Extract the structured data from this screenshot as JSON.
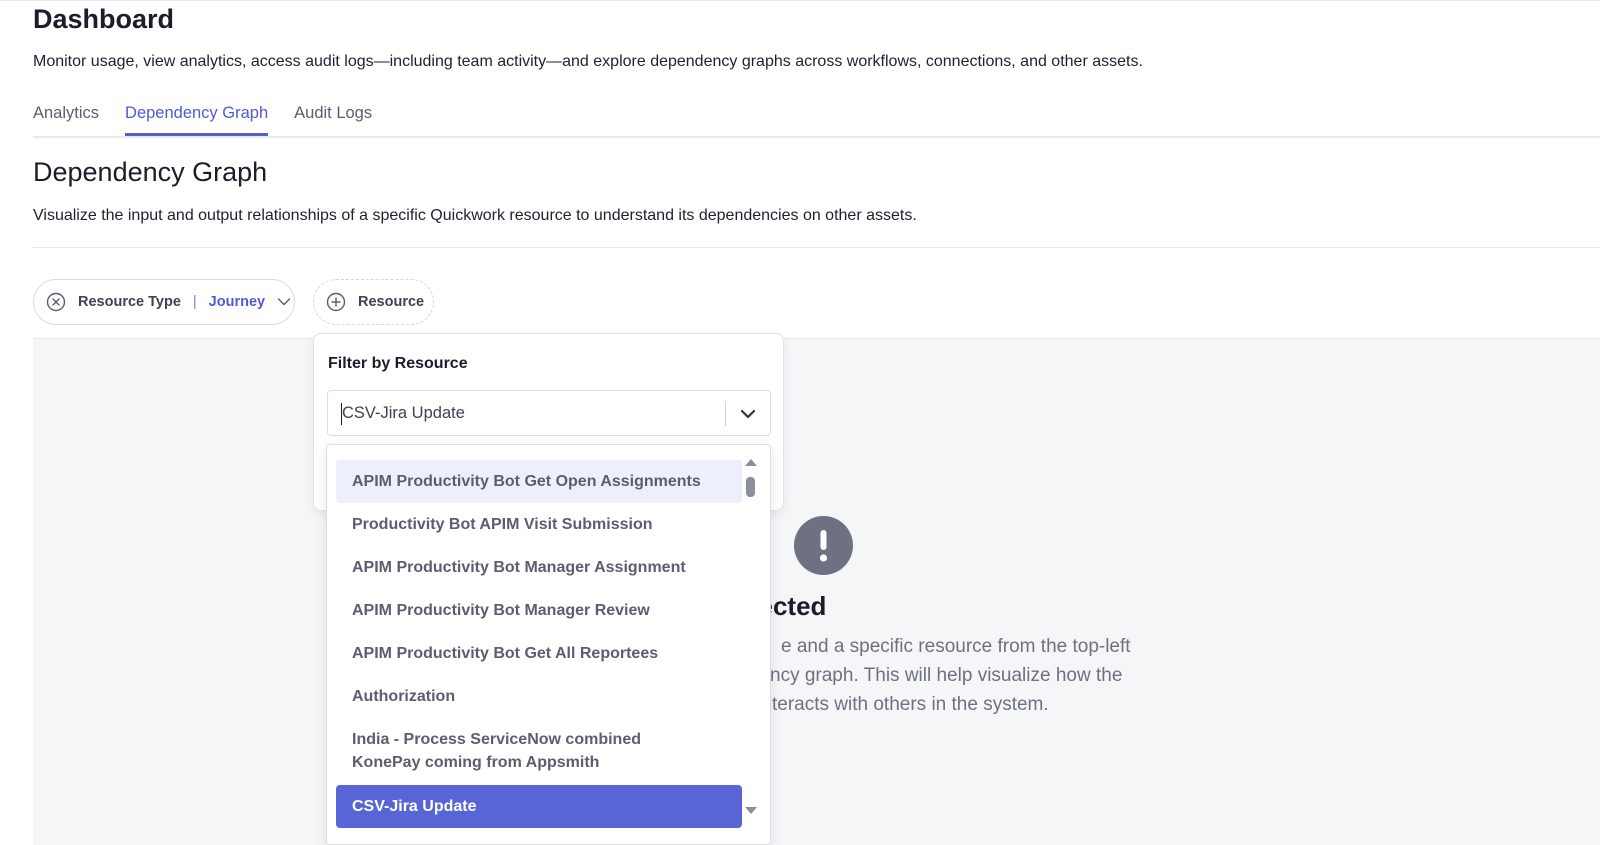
{
  "header": {
    "title": "Dashboard",
    "description": "Monitor usage, view analytics, access audit logs—including team activity—and explore dependency graphs across workflows, connections, and other assets."
  },
  "tabs": [
    {
      "label": "Analytics",
      "active": false
    },
    {
      "label": "Dependency Graph",
      "active": true
    },
    {
      "label": "Audit Logs",
      "active": false
    }
  ],
  "section": {
    "title": "Dependency Graph",
    "description": "Visualize the input and output relationships of a specific Quickwork resource to understand its dependencies on other assets."
  },
  "filters": {
    "resource_type": {
      "label": "Resource Type",
      "value": "Journey",
      "icon": "close-circle-icon"
    },
    "resource": {
      "label": "Resource",
      "icon": "plus-circle-icon"
    }
  },
  "popover": {
    "title": "Filter by Resource",
    "selected_value": "CSV-Jira Update"
  },
  "options": [
    {
      "label": "APIM Productivity Bot Get Open Assignments",
      "state": "hover"
    },
    {
      "label": "Productivity Bot APIM Visit Submission",
      "state": ""
    },
    {
      "label": "APIM Productivity Bot Manager Assignment",
      "state": ""
    },
    {
      "label": "APIM Productivity Bot Manager Review",
      "state": ""
    },
    {
      "label": "APIM Productivity Bot Get All Reportees",
      "state": ""
    },
    {
      "label": "Authorization",
      "state": ""
    },
    {
      "label": "India - Process ServiceNow combined KonePay coming from Appsmith",
      "state": ""
    },
    {
      "label": "CSV-Jira Update",
      "state": "selected"
    }
  ],
  "empty_state": {
    "icon": "exclamation-circle-icon",
    "title_visible": "souce selected",
    "lines_visible": [
      "e and a specific resource from the top-left",
      "ncy graph. This will help visualize how the",
      "teracts with others in the system."
    ]
  },
  "colors": {
    "accent": "#5865d6",
    "empty_icon": "#6d7181",
    "canvas_bg": "#f5f6f8"
  }
}
